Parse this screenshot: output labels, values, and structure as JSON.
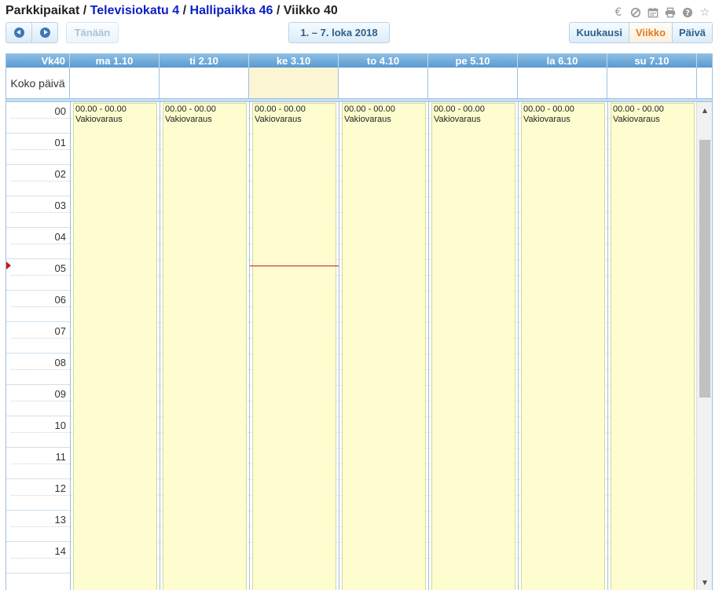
{
  "breadcrumb": {
    "root": "Parkkipaikat",
    "separator": "/",
    "location": "Televisiokatu 4",
    "spot": "Hallipaikka 46",
    "current": "Viikko 40"
  },
  "top_icons": [
    "euro-icon",
    "block-icon",
    "calendar-icon",
    "print-icon",
    "help-icon",
    "star-icon"
  ],
  "toolbar": {
    "today_label": "Tänään",
    "range_label": "1. – 7. loka 2018",
    "views": [
      {
        "id": "month",
        "label": "Kuukausi",
        "active": false
      },
      {
        "id": "week",
        "label": "Viikko",
        "active": true
      },
      {
        "id": "day",
        "label": "Päivä",
        "active": false
      }
    ]
  },
  "calendar": {
    "week_label": "Vk40",
    "allday_label": "Koko päivä",
    "days": [
      {
        "label": "ma 1.10",
        "today": false
      },
      {
        "label": "ti 2.10",
        "today": false
      },
      {
        "label": "ke 3.10",
        "today": true
      },
      {
        "label": "to 4.10",
        "today": false
      },
      {
        "label": "pe 5.10",
        "today": false
      },
      {
        "label": "la 6.10",
        "today": false
      },
      {
        "label": "su 7.10",
        "today": false
      }
    ],
    "hours": [
      "00",
      "01",
      "02",
      "03",
      "04",
      "05",
      "06",
      "07",
      "08",
      "09",
      "10",
      "11",
      "12",
      "13",
      "14"
    ],
    "event": {
      "time": "00.00 - 00.00",
      "title": "Vakiovaraus"
    },
    "now_hour": 5.2,
    "colors": {
      "header": "#5a9ad1",
      "event_bg": "#fdfdcf",
      "today_bg": "#fcf5d4",
      "now_line": "#c41a1a",
      "link": "#0d1fc2",
      "active_view": "#e07a1f"
    }
  }
}
